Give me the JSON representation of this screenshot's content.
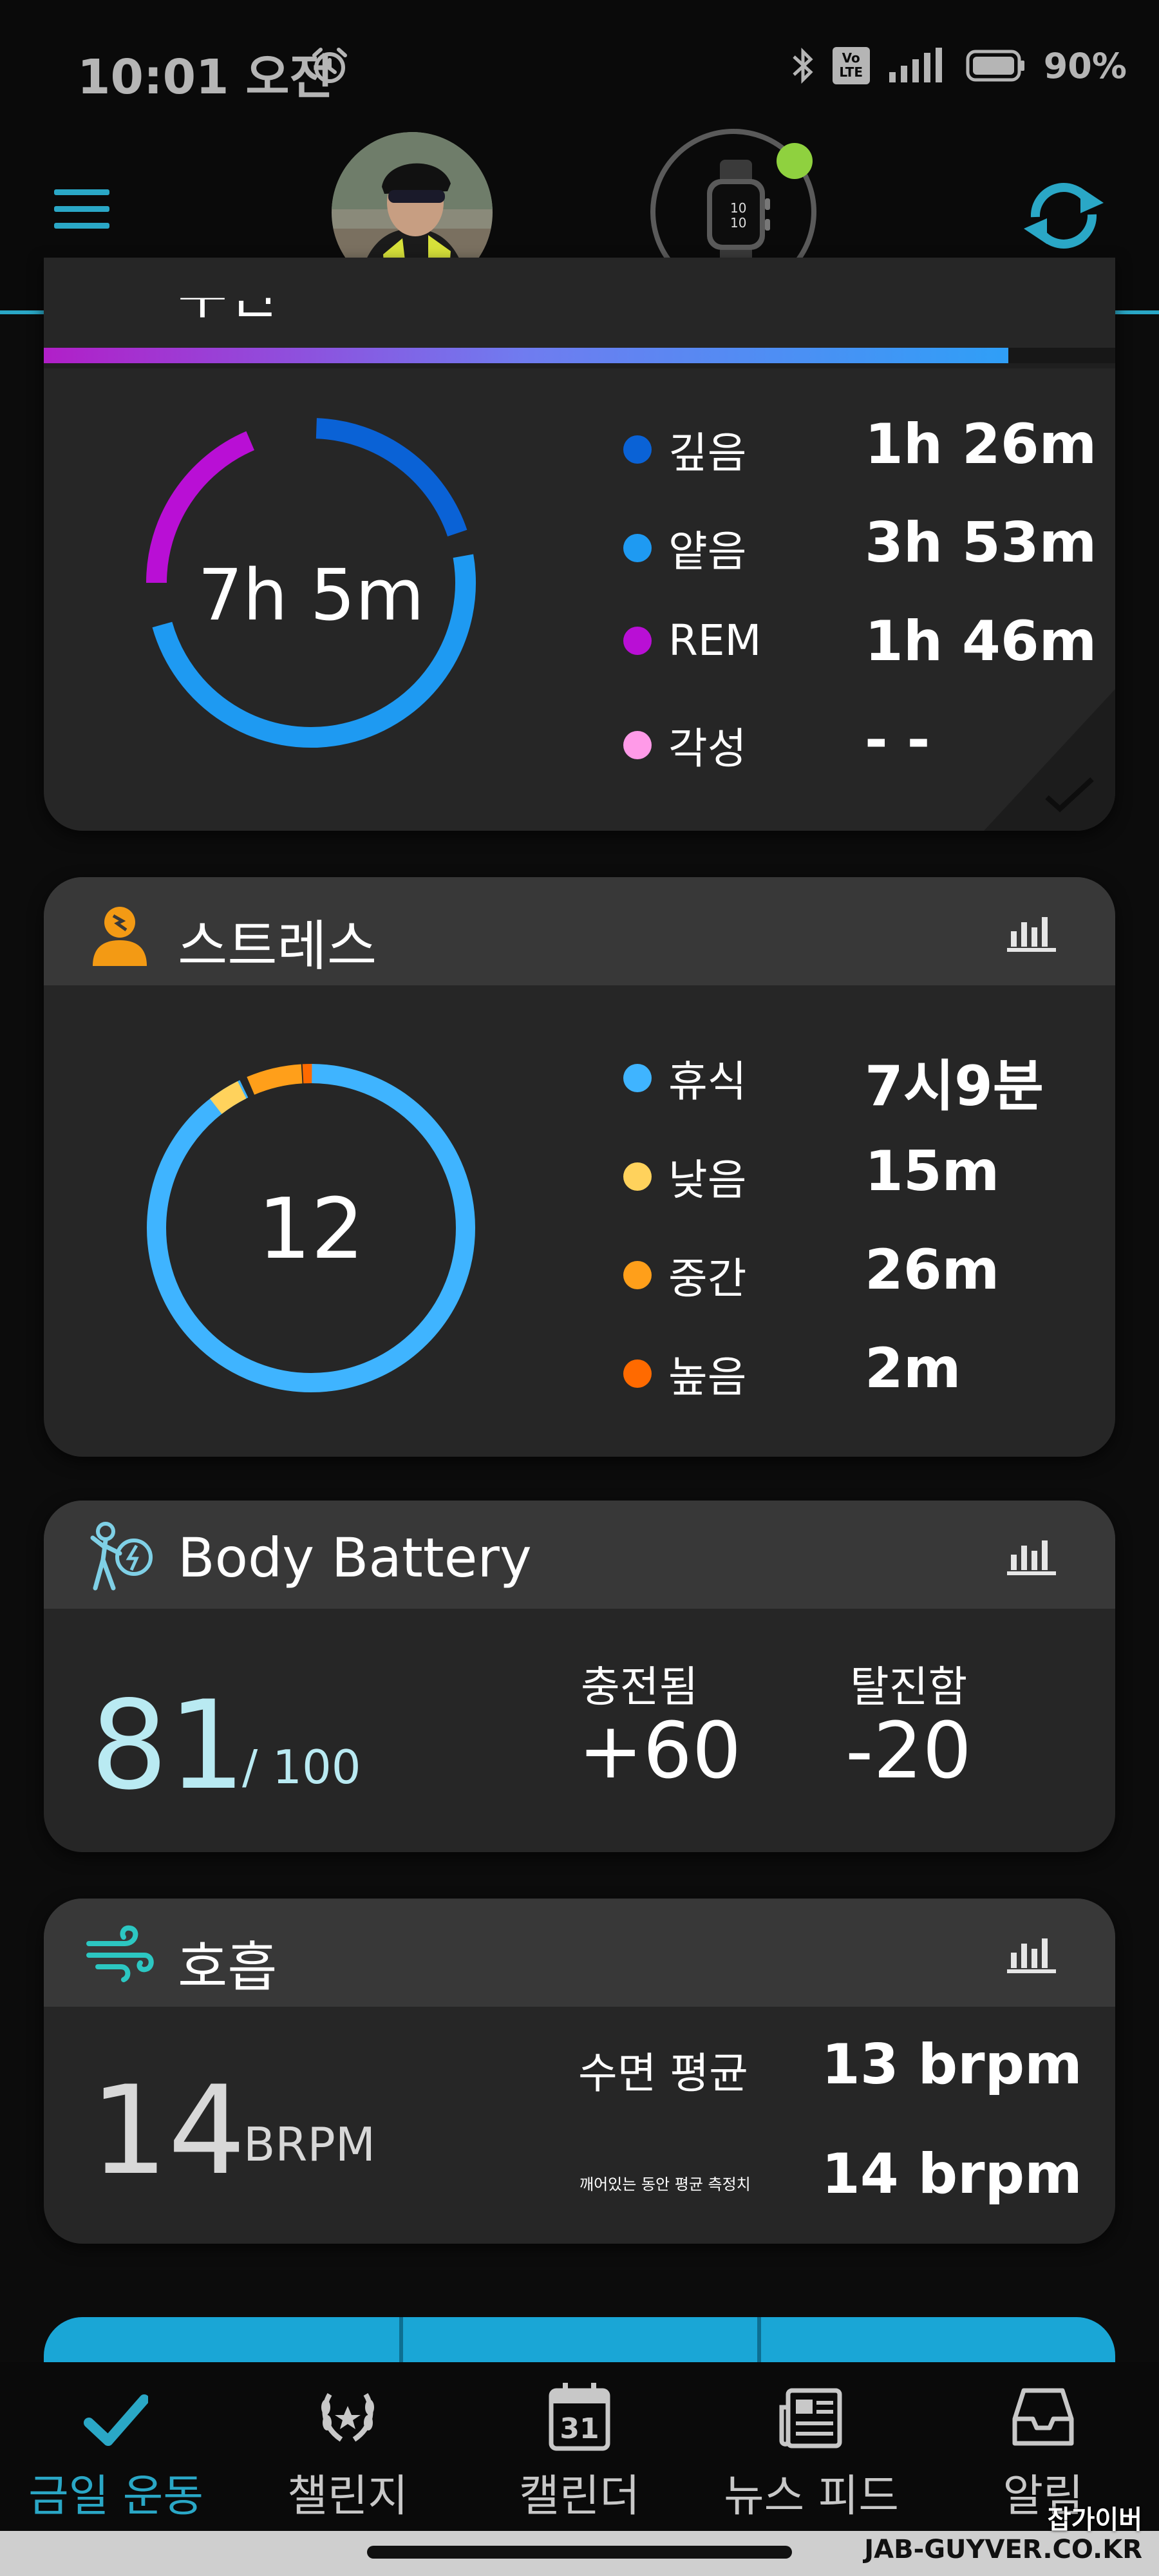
{
  "status_bar": {
    "time": "10:01 오전",
    "battery": "90%",
    "volte_top": "Vo",
    "volte_bottom": "LTE"
  },
  "header": {
    "watch_time_top": "10",
    "watch_time_bottom": "10"
  },
  "sleep": {
    "title_partial": "수면",
    "progress_fraction": 0.9,
    "total": "7h 5m",
    "legend": [
      {
        "label": "깊음",
        "value": "1h 26m",
        "color": "#0a62d6"
      },
      {
        "label": "얕음",
        "value": "3h 53m",
        "color": "#1e9af2"
      },
      {
        "label": "REM",
        "value": "1h 46m",
        "color": "#b90fd5"
      },
      {
        "label": "각성",
        "value": "- -",
        "color": "#ff9ae8"
      }
    ]
  },
  "stress": {
    "title": "스트레스",
    "score": "12",
    "legend": [
      {
        "label": "휴식",
        "value": "7시9분",
        "color": "#3fb4ff"
      },
      {
        "label": "낮음",
        "value": "15m",
        "color": "#ffd25c"
      },
      {
        "label": "중간",
        "value": "26m",
        "color": "#ff9f1a"
      },
      {
        "label": "높음",
        "value": "2m",
        "color": "#ff6a00"
      }
    ]
  },
  "body_battery": {
    "title": "Body Battery",
    "value": "81",
    "max": "/ 100",
    "charged_label": "충전됨",
    "charged_value": "+60",
    "drained_label": "탈진함",
    "drained_value": "-20"
  },
  "respiration": {
    "title": "호흡",
    "value": "14",
    "unit": "BRPM",
    "sleep_avg_label": "수면 평균",
    "sleep_avg_value": "13 brpm",
    "awake_avg_label": "깨어있는 동안 평균 측정치",
    "awake_avg_value": "14 brpm"
  },
  "nav": {
    "items": [
      {
        "label": "금일 운동",
        "active": true
      },
      {
        "label": "챌린지",
        "active": false
      },
      {
        "label": "캘린더",
        "active": false
      },
      {
        "label": "뉴스 피드",
        "active": false
      },
      {
        "label": "알림",
        "active": false
      }
    ],
    "calendar_day": "31"
  },
  "watermark": {
    "line1": "잡가이버",
    "line2": "JAB-GUYVER.CO.KR"
  },
  "colors": {
    "accent": "#2aa7c6",
    "card_bg": "#262626",
    "card_head": "#383838"
  }
}
